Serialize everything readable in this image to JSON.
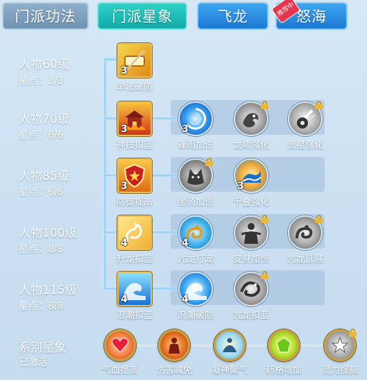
{
  "tabs": [
    {
      "label": "门派功法"
    },
    {
      "label": "门派星象"
    },
    {
      "label": "飞龙"
    },
    {
      "label": "怒海",
      "badge": "推荐中"
    }
  ],
  "tiers": [
    {
      "title": "人物60级",
      "stars_label": "星点：",
      "stars_value": "3/3",
      "skills": [
        {
          "name": "单法破防",
          "level": "3",
          "icon": "scroll-sword-icon"
        }
      ]
    },
    {
      "title": "人物70级",
      "stars_label": "星点：",
      "stars_value": "6/6",
      "skills": [
        {
          "name": "神技扣蓝",
          "level": "3",
          "icon": "flame-temple-icon"
        },
        {
          "name": "骤雨加伤",
          "level": "3",
          "icon": "water-vortex-icon"
        },
        {
          "name": "龙啸强化",
          "level": "",
          "icon": "dragon-roar-icon",
          "locked": true
        },
        {
          "name": "流星强化",
          "level": "",
          "icon": "meteor-icon",
          "locked": true
        }
      ]
    },
    {
      "title": "人物85级",
      "stars_label": "星点：",
      "stars_value": "6/6",
      "skills": [
        {
          "name": "防御提高",
          "level": "3",
          "icon": "shield-icon"
        },
        {
          "name": "坐骑加伤",
          "level": "",
          "icon": "wolf-mount-icon",
          "locked": true
        },
        {
          "name": "千叠强化",
          "level": "3",
          "icon": "wave-fan-icon"
        }
      ]
    },
    {
      "title": "人物100级",
      "stars_label": "星点：",
      "stars_value": "8/8",
      "skills": [
        {
          "name": "升龙扣蓝",
          "level": "4",
          "icon": "rising-dragon-icon"
        },
        {
          "name": "亢龙打宠",
          "level": "4",
          "icon": "coiled-dragon-icon"
        },
        {
          "name": "变身加伤",
          "level": "",
          "icon": "transform-figure-icon",
          "locked": true
        },
        {
          "name": "亢龙延展",
          "level": "",
          "icon": "dragon-extend-icon",
          "locked": true
        }
      ]
    },
    {
      "title": "人物115级",
      "stars_label": "星点：",
      "stars_value": "8/8",
      "skills": [
        {
          "name": "浪潮扣蓝",
          "level": "4",
          "icon": "tidal-wave-icon"
        },
        {
          "name": "浪潮破防",
          "level": "4",
          "icon": "tidal-break-icon"
        },
        {
          "name": "亢龙扣蓝",
          "level": "",
          "icon": "dragon-drain-icon",
          "locked": true
        }
      ]
    }
  ],
  "constellation": {
    "title": "系别星象",
    "status": "已激活",
    "items": [
      {
        "name": "气血提高",
        "icon": "heart-icon"
      },
      {
        "name": "伤害减免",
        "icon": "armor-figure-icon"
      },
      {
        "name": "凝神聚气",
        "icon": "meditation-icon"
      },
      {
        "name": "药格增加",
        "icon": "green-gem-icon"
      },
      {
        "name": "灵力提高",
        "icon": "spirit-star-icon",
        "locked": true
      }
    ]
  },
  "colors": {
    "tab_active": "#19b3ae",
    "tab_inactive": "#7d9fbe",
    "tab_blue": "#2a8ae0",
    "tree_line": "#9fd3f8",
    "icon_border_gold": "#e8c060"
  }
}
